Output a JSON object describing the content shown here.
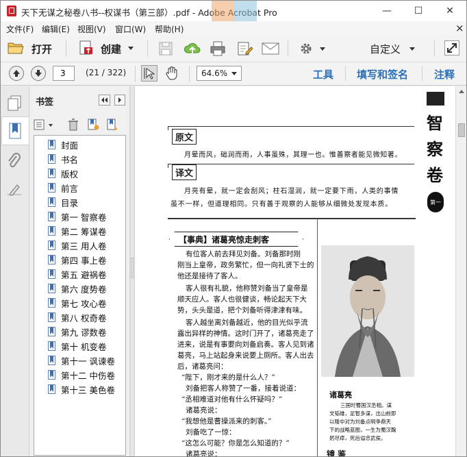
{
  "window": {
    "title": "天下无谋之秘卷八书--权谋书（第三部）.pdf - Adobe Acrobat Pro",
    "controls": {
      "minimize": "—",
      "maximize": "☐",
      "close": "✕"
    }
  },
  "menu": {
    "items": [
      "文件(F)",
      "编辑(E)",
      "视图(V)",
      "窗口(W)",
      "帮助(H)"
    ],
    "close_doc": "×"
  },
  "toolbar": {
    "open_label": "打开",
    "create_label": "创建",
    "customize_label": "自定义"
  },
  "nav": {
    "page_value": "3",
    "page_status": "(21 / 322)",
    "zoom_value": "64.6%",
    "tools_label": "工具",
    "fill_sign_label": "填写和签名",
    "comment_label": "注释"
  },
  "bookmarks": {
    "panel_title": "书签",
    "items": [
      "封面",
      "书名",
      "版权",
      "前言",
      "目录",
      "第一 智察卷",
      "第二 筹谋卷",
      "第三 用人卷",
      "第四 事上卷",
      "第五 避祸卷",
      "第六 度势卷",
      "第七 攻心卷",
      "第八 权奇卷",
      "第九 谬数卷",
      "第十 机变卷",
      "第十一 讽谏卷",
      "第十二 中伤卷",
      "第十三 美色卷"
    ]
  },
  "page": {
    "side_title": [
      "智",
      "察",
      "卷"
    ],
    "side_mark": "第一",
    "yuanwen_label": "原文",
    "yuanwen_text": "月晕而风，础润而雨，人事虽殊，其理一也。惟善察者能见微知著。",
    "yiwen_label": "译文",
    "yiwen_lines": [
      "月亮有晕，就一定会刮风；柱石湿润，就一定要下雨，人类的事情",
      "虽不一样，但道理相同。只有善于观察的人能够从细微处发现本质。"
    ],
    "section_title": "【事典】诸葛亮惊走刺客",
    "story_lines": [
      "有位客人前去拜见刘备。刘备那时刚",
      "刚当上皇帝，政务繁忙，但一向礼贤下士的",
      "他还是接待了客人。",
      "客人很有礼貌，他称赞刘备当了皇帝是",
      "顺天应人。客人也很健谈，畅论起天下大",
      "势，头头是道，把个刘备听得津津有味。",
      "客人越坐离刘备越近，他的目光似乎流",
      "露出异样的神情。这时门开了，诸葛亮走了",
      "进来，说是有事要向刘备启奏。客人见到诸",
      "葛亮，马上站起身来说要上厕所。客人出去",
      "后，诸葛亮问："
    ],
    "dialog_lines": [
      "“陛下，刚才来的是什么人？”",
      "刘备把客人称赞了一番，接着说道：",
      "“丞相难道对他有什么怀疑吗？”",
      "诸葛亮说：",
      "“我想他是曹操派来的刺客。”",
      "刘备吃了一惊：",
      "“这怎么可能？你是怎么知道的？”",
      "诸葛亮说："
    ],
    "portrait_caption": "诸葛亮",
    "portrait_desc": [
      "三国时蜀国汉丞相。谋",
      "文韬雄，足智多谋，出山前即",
      "以隆中对为刘备点明争鼎天",
      "下的战略蓝图，一生为蜀汉鞠",
      "躬尽瘁，死后谥忠武侯。"
    ],
    "mirror_label": "镜  鉴"
  }
}
